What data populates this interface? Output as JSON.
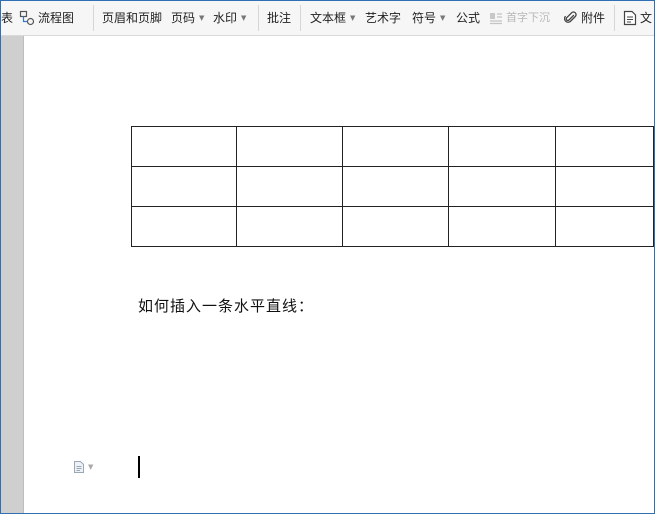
{
  "toolbar": {
    "items": [
      {
        "label": "表",
        "icon": null,
        "dropdown": false,
        "disabled": false
      },
      {
        "label": "流程图",
        "icon": "flowchart-icon",
        "dropdown": false,
        "disabled": false
      },
      {
        "label": "页眉和页脚",
        "icon": null,
        "dropdown": false,
        "disabled": false
      },
      {
        "label": "页码",
        "icon": null,
        "dropdown": true,
        "disabled": false
      },
      {
        "label": "水印",
        "icon": null,
        "dropdown": true,
        "disabled": false
      },
      {
        "label": "批注",
        "icon": null,
        "dropdown": false,
        "disabled": false
      },
      {
        "label": "文本框",
        "icon": null,
        "dropdown": true,
        "disabled": false
      },
      {
        "label": "艺术字",
        "icon": null,
        "dropdown": false,
        "disabled": false
      },
      {
        "label": "符号",
        "icon": null,
        "dropdown": true,
        "disabled": false
      },
      {
        "label": "公式",
        "icon": null,
        "dropdown": false,
        "disabled": false
      },
      {
        "label": "首字下沉",
        "icon": "drop-cap-icon",
        "dropdown": false,
        "disabled": true
      },
      {
        "label": "附件",
        "icon": "paperclip-icon",
        "dropdown": false,
        "disabled": false
      },
      {
        "label": "文",
        "icon": "document-icon",
        "dropdown": false,
        "disabled": false
      }
    ]
  },
  "document": {
    "table": {
      "rows": 3,
      "columns": 5
    },
    "paragraph": "如何插入一条水平直线："
  },
  "colors": {
    "frame_border": "#2f6fb4",
    "toolbar_bg": "#f6f6f6",
    "disabled_text": "#b8b8b8"
  }
}
